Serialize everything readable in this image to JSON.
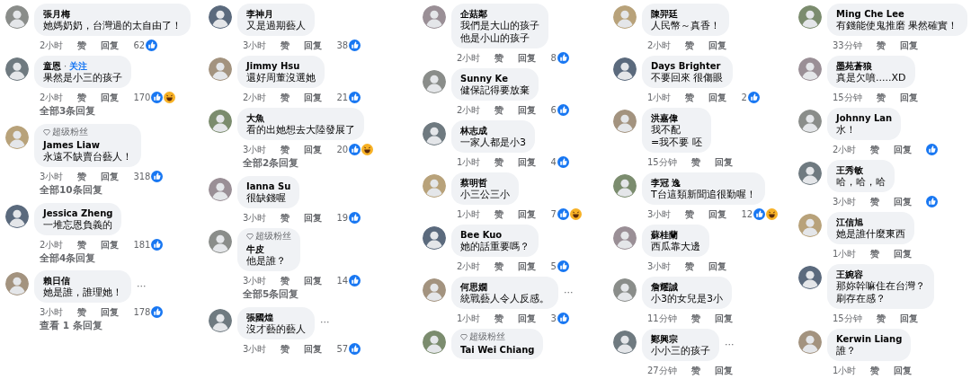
{
  "columns": [
    {
      "comments": [
        {
          "name": "張月梅",
          "text": "她媽奶奶，台灣過的太自由了！",
          "time": "2小时",
          "like_label": "赞",
          "reply_label": "回复",
          "likes": "62",
          "reactions": [
            {
              "kind": "like"
            }
          ]
        },
        {
          "name": "童恩",
          "separator": "·",
          "follow": "关注",
          "text": "果然是小三的孩子",
          "time": "2小时",
          "like_label": "赞",
          "reply_label": "回复",
          "likes": "170",
          "reactions": [
            {
              "kind": "like"
            },
            {
              "kind": "haha"
            }
          ],
          "replies_link": "全部3条回复"
        },
        {
          "badge": "超级粉丝",
          "name": "James Liaw",
          "text": "永遠不缺賣台藝人！",
          "time": "3小时",
          "like_label": "赞",
          "reply_label": "回复",
          "likes": "318",
          "reactions": [
            {
              "kind": "like"
            }
          ],
          "replies_link": "全部10条回复"
        },
        {
          "name": "Jessica Zheng",
          "text": "一堆忘恩負義的",
          "time": "2小时",
          "like_label": "赞",
          "reply_label": "回复",
          "likes": "181",
          "reactions": [
            {
              "kind": "like"
            }
          ],
          "replies_link": "全部4条回复"
        },
        {
          "name": "賴日信",
          "text": "她是誰，誰理她！",
          "menu": "···",
          "time": "3小时",
          "like_label": "赞",
          "reply_label": "回复",
          "likes": "178",
          "reactions": [
            {
              "kind": "like"
            }
          ],
          "replies_link": "查看 1 条回复"
        }
      ]
    },
    {
      "comments": [
        {
          "name": "李神月",
          "text": "又是過期藝人",
          "time": "3小时",
          "like_label": "赞",
          "reply_label": "回复",
          "likes": "38",
          "reactions": [
            {
              "kind": "like"
            }
          ]
        },
        {
          "name": "Jimmy Hsu",
          "text": "還好周董沒選她",
          "time": "2小时",
          "like_label": "赞",
          "reply_label": "回复",
          "likes": "21",
          "reactions": [
            {
              "kind": "like"
            }
          ]
        },
        {
          "name": "大魚",
          "text": "看的出她想去大陸發展了",
          "time": "3小时",
          "like_label": "赞",
          "reply_label": "回复",
          "likes": "20",
          "reactions": [
            {
              "kind": "like"
            },
            {
              "kind": "haha"
            }
          ],
          "replies_link": "全部2条回复"
        },
        {
          "name": "Ianna Su",
          "text": "很缺錢喔",
          "time": "3小时",
          "like_label": "赞",
          "reply_label": "回复",
          "likes": "19",
          "reactions": [
            {
              "kind": "like"
            }
          ]
        },
        {
          "badge": "超级粉丝",
          "name": "牛皮",
          "text": "他是誰？",
          "time": "3小时",
          "like_label": "赞",
          "reply_label": "回复",
          "likes": "14",
          "reactions": [
            {
              "kind": "like"
            }
          ],
          "replies_link": "全部5条回复"
        },
        {
          "name": "張國煌",
          "text": "沒才藝的藝人",
          "menu": "···",
          "time": "3小时",
          "like_label": "赞",
          "reply_label": "回复",
          "likes": "57",
          "reactions": [
            {
              "kind": "like"
            }
          ]
        }
      ]
    },
    {
      "comments": [
        {
          "name": "企菇鄰",
          "lines": [
            "我們是大山的孩子",
            "他是小山的孩子"
          ],
          "time": "2小时",
          "like_label": "赞",
          "reply_label": "回复",
          "likes": "8",
          "reactions": [
            {
              "kind": "like"
            }
          ]
        },
        {
          "name": "Sunny Ke",
          "text": "健保記得要放棄",
          "time": "2小时",
          "like_label": "赞",
          "reply_label": "回复",
          "likes": "6",
          "reactions": [
            {
              "kind": "like"
            }
          ]
        },
        {
          "name": "林志成",
          "text": "一家人都是小3",
          "time": "1小时",
          "like_label": "赞",
          "reply_label": "回复",
          "likes": "4",
          "reactions": [
            {
              "kind": "like"
            }
          ]
        },
        {
          "name": "蔡明哲",
          "text": "小三公三小",
          "time": "1小时",
          "like_label": "赞",
          "reply_label": "回复",
          "likes": "7",
          "reactions": [
            {
              "kind": "like"
            },
            {
              "kind": "haha"
            }
          ]
        },
        {
          "name": "Bee Kuo",
          "text": "她的話重要嗎？",
          "time": "2小时",
          "like_label": "赞",
          "reply_label": "回复",
          "likes": "5",
          "reactions": [
            {
              "kind": "like"
            }
          ]
        },
        {
          "name": "何思嫺",
          "text": "統戰藝人令人反感。",
          "menu": "···",
          "time": "1小时",
          "like_label": "赞",
          "reply_label": "回复",
          "likes": "3",
          "reactions": [
            {
              "kind": "like"
            }
          ]
        },
        {
          "badge": "超级粉丝",
          "name": "Tai Wei Chiang"
        }
      ]
    },
    {
      "comments": [
        {
          "name": "陳羿廷",
          "text": "人民幣～真香！",
          "time": "2小时",
          "like_label": "赞",
          "reply_label": "回复"
        },
        {
          "name": "Days Brighter",
          "text": "不要回來 很傷眼",
          "time": "1小时",
          "like_label": "赞",
          "reply_label": "回复",
          "likes": "2",
          "reactions": [
            {
              "kind": "like"
            }
          ]
        },
        {
          "name": "洪嘉偉",
          "lines": [
            "我不配",
            "=我不要 呸"
          ],
          "time": "15分钟",
          "like_label": "赞",
          "reply_label": "回复"
        },
        {
          "name": "李冠 逸",
          "text": "T台這類新聞追很勤喔！",
          "time": "3小时",
          "like_label": "赞",
          "reply_label": "回复",
          "likes": "12",
          "reactions": [
            {
              "kind": "like"
            },
            {
              "kind": "haha"
            }
          ]
        },
        {
          "name": "蘇桂蘭",
          "text": "西瓜靠大邊",
          "time": "3小时",
          "like_label": "赞",
          "reply_label": "回复"
        },
        {
          "name": "詹耀誠",
          "text": "小3的女兒是3小",
          "time": "11分钟",
          "like_label": "赞",
          "reply_label": "回复"
        },
        {
          "name": "鄭興宗",
          "text": "小小三的孩子",
          "menu": "···",
          "time": "27分钟",
          "like_label": "赞",
          "reply_label": "回复"
        }
      ]
    },
    {
      "comments": [
        {
          "name": "Ming Che Lee",
          "text": "有錢能使鬼推磨 果然確實！",
          "time": "33分钟",
          "like_label": "赞",
          "reply_label": "回复"
        },
        {
          "name": "墨苑蒼狼",
          "text": "真是欠噴.....XD",
          "time": "15分钟",
          "like_label": "赞",
          "reply_label": "回复"
        },
        {
          "name": "Johnny Lan",
          "text": "水！",
          "time": "2小时",
          "like_label": "赞",
          "reply_label": "回复",
          "reactions": [
            {
              "kind": "like"
            }
          ]
        },
        {
          "name": "王秀敏",
          "text": "哈，哈，哈",
          "time": "3小时",
          "like_label": "赞",
          "reply_label": "回复",
          "reactions": [
            {
              "kind": "like"
            }
          ]
        },
        {
          "name": "江信旭",
          "text": "她是誰什麼東西",
          "time": "1小时",
          "like_label": "赞",
          "reply_label": "回复"
        },
        {
          "name": "王婉容",
          "lines": [
            "那妳幹嘛住在台灣？",
            "刷存在感？"
          ],
          "time": "15分钟",
          "like_label": "赞",
          "reply_label": "回复"
        },
        {
          "name": "Kerwin Liang",
          "text": "誰？",
          "time": "1小时",
          "like_label": "赞",
          "reply_label": "回复"
        }
      ]
    }
  ]
}
